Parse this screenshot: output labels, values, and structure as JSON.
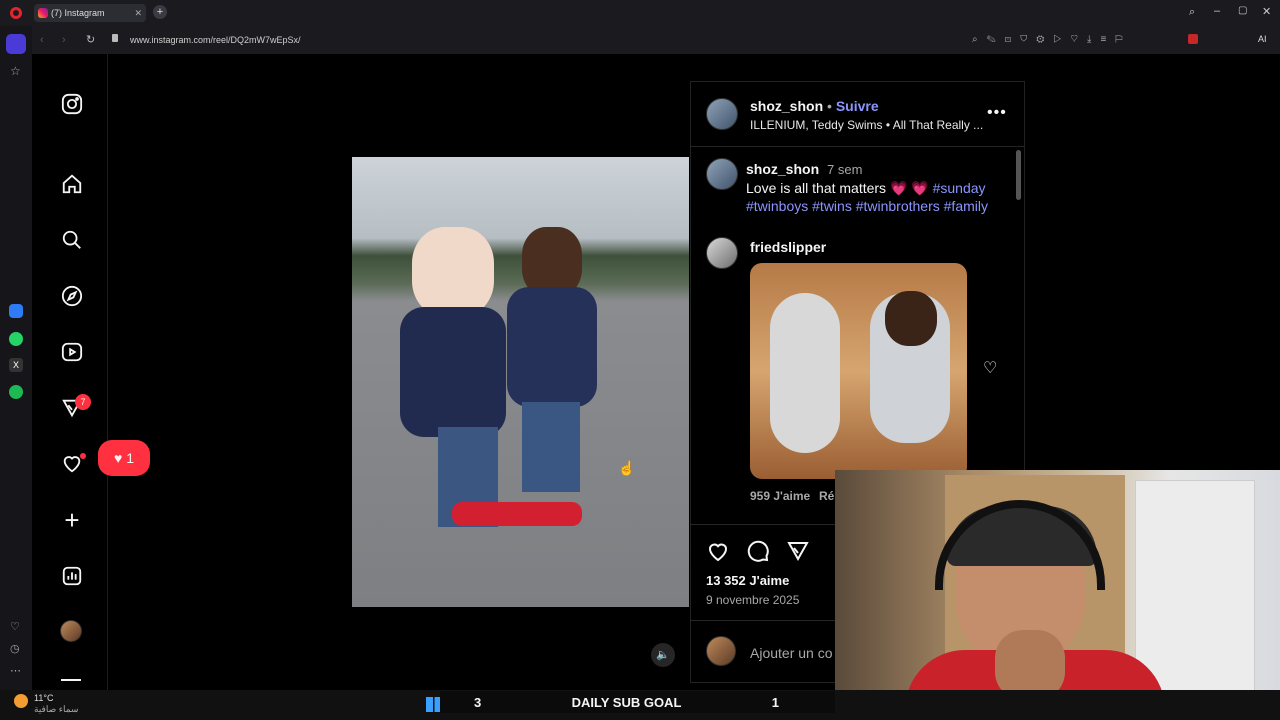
{
  "browser": {
    "tab_label": "(7) Instagram",
    "url": "www.instagram.com/reel/DQ2mW7wEpSx/",
    "ai_label": "AI"
  },
  "sidebar": {
    "notif_count": "7",
    "like_count": "1",
    "icons": [
      "instagram-icon",
      "home-icon",
      "search-icon",
      "explore-icon",
      "reels-icon",
      "messages-icon",
      "heart-icon",
      "create-icon",
      "dashboard-icon",
      "avatar",
      "menu-icon"
    ]
  },
  "post": {
    "username": "shoz_shon",
    "follow_sep": "•",
    "follow_label": "Suivre",
    "audio": "ILLENIUM, Teddy Swims • All That Really ...",
    "caption": {
      "username": "shoz_shon",
      "age": "7 sem",
      "text": "Love is all that matters 💗 💗",
      "tags_line1": "#sunday",
      "tags_line2": "#twinboys #twins #twinbrothers #family"
    },
    "comment": {
      "username": "friedslipper",
      "likes": "959 J'aime",
      "reply": "Rép"
    },
    "likes": "13 352 J'aime",
    "date": "9 novembre 2025",
    "add_comment_placeholder": "Ajouter un co"
  },
  "taskbar": {
    "temp": "11°C",
    "weather": "سماء صافية",
    "goal_left": "3",
    "goal_label": "DAILY SUB GOAL",
    "goal_right": "1"
  },
  "colors": {
    "accent_blue": "#8a95ff",
    "badge_red": "#ff3040"
  }
}
